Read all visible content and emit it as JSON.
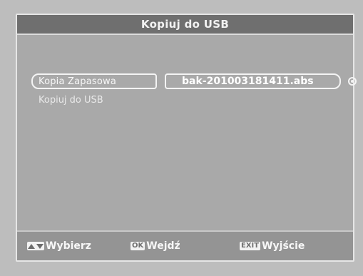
{
  "window": {
    "title": "Kopiuj do USB"
  },
  "menu": {
    "items": [
      {
        "label": "Kopia Zapasowa",
        "value": "bak-201003181411.abs"
      },
      {
        "label": "Kopiuj do USB"
      }
    ]
  },
  "footer": {
    "hints": [
      {
        "key": "▲▼",
        "label": "Wybierz",
        "icon": "up-down-arrows-icon"
      },
      {
        "key": "OK",
        "label": "Wejdź"
      },
      {
        "key": "EXIT",
        "label": "Wyjście"
      }
    ]
  }
}
